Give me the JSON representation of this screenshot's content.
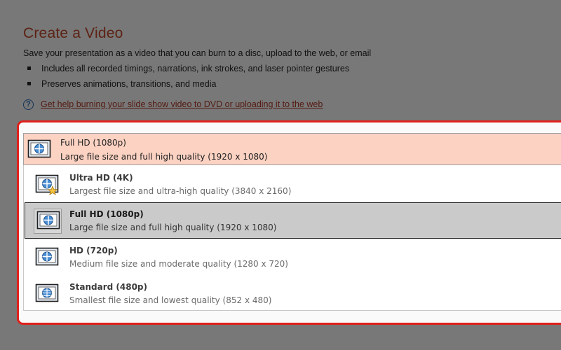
{
  "header": {
    "title": "Create a Video",
    "description": "Save your presentation as a video that you can burn to a disc, upload to the web, or email",
    "bullets": [
      "Includes all recorded timings, narrations, ink strokes, and laser pointer gestures",
      "Preserves animations, transitions, and media"
    ],
    "help_link": "Get help burning your slide show video to DVD or uploading it to the web"
  },
  "quality_dropdown": {
    "selected_name": "Full HD (1080p)",
    "selected_detail": "Large file size and full high quality (1920 x 1080)",
    "options": [
      {
        "name": "Ultra HD (4K)",
        "detail": "Largest file size and ultra-high quality (3840 x 2160)",
        "icon": "ultra-hd-star-icon"
      },
      {
        "name": "Full HD (1080p)",
        "detail": "Large file size and full high quality (1920 x 1080)",
        "icon": "full-hd-icon"
      },
      {
        "name": "HD (720p)",
        "detail": "Medium file size and moderate quality (1280 x 720)",
        "icon": "hd-icon"
      },
      {
        "name": "Standard (480p)",
        "detail": "Smallest file size and lowest quality (852 x 480)",
        "icon": "standard-icon"
      }
    ],
    "selected_index": 1
  },
  "colors": {
    "title": "#c34a2c",
    "help_link": "#b13a26",
    "highlight_frame": "#e0201b",
    "selector_bg": "#fcd2c2",
    "selected_option_bg": "#cacaca"
  }
}
